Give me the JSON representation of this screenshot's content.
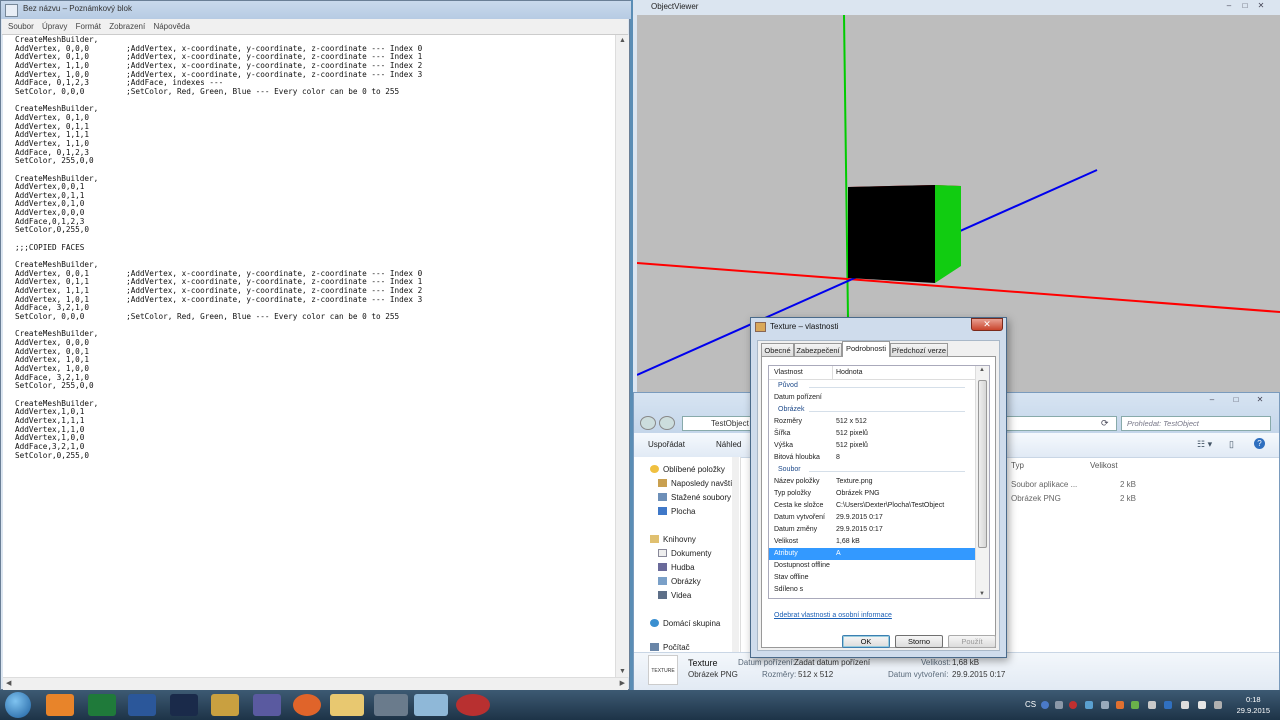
{
  "notepad": {
    "title": "Bez názvu – Poznámkový blok",
    "menu": [
      "Soubor",
      "Úpravy",
      "Formát",
      "Zobrazení",
      "Nápověda"
    ],
    "content": "CreateMeshBuilder,\nAddVertex, 0,0,0        ;AddVertex, x-coordinate, y-coordinate, z-coordinate --- Index 0\nAddVertex, 0,1,0        ;AddVertex, x-coordinate, y-coordinate, z-coordinate --- Index 1\nAddVertex, 1,1,0        ;AddVertex, x-coordinate, y-coordinate, z-coordinate --- Index 2\nAddVertex, 1,0,0        ;AddVertex, x-coordinate, y-coordinate, z-coordinate --- Index 3\nAddFace, 0,1,2,3        ;AddFace, indexes ---\nSetColor, 0,0,0         ;SetColor, Red, Green, Blue --- Every color can be 0 to 255\n\nCreateMeshBuilder,\nAddVertex, 0,1,0\nAddVertex, 0,1,1\nAddVertex, 1,1,1\nAddVertex, 1,1,0\nAddFace, 0,1,2,3\nSetColor, 255,0,0\n\nCreateMeshBuilder,\nAddVertex,0,0,1\nAddVertex,0,1,1\nAddVertex,0,1,0\nAddVertex,0,0,0\nAddFace,0,1,2,3\nSetColor,0,255,0\n\n;;;COPIED FACES\n\nCreateMeshBuilder,\nAddVertex, 0,0,1        ;AddVertex, x-coordinate, y-coordinate, z-coordinate --- Index 0\nAddVertex, 0,1,1        ;AddVertex, x-coordinate, y-coordinate, z-coordinate --- Index 1\nAddVertex, 1,1,1        ;AddVertex, x-coordinate, y-coordinate, z-coordinate --- Index 2\nAddVertex, 1,0,1        ;AddVertex, x-coordinate, y-coordinate, z-coordinate --- Index 3\nAddFace, 3,2,1,0\nSetColor, 0,0,0         ;SetColor, Red, Green, Blue --- Every color can be 0 to 255\n\nCreateMeshBuilder,\nAddVertex, 0,0,0\nAddVertex, 0,0,1\nAddVertex, 1,0,1\nAddVertex, 1,0,0\nAddFace, 3,2,1,0\nSetColor, 255,0,0\n\nCreateMeshBuilder,\nAddVertex,1,0,1\nAddVertex,1,1,1\nAddVertex,1,1,0\nAddVertex,1,0,0\nAddFace,3,2,1,0\nSetColor,0,255,0"
  },
  "viewer": {
    "title": "ObjectViewer",
    "background": "#bdbdbd",
    "axis_colors": {
      "x": "#ff0000",
      "y": "#00cc00",
      "z": "#0000ee"
    }
  },
  "explorer": {
    "address": "TestObject",
    "search_placeholder": "Prohledat: TestObject",
    "toolbar": {
      "organize": "Uspořádat",
      "second": "Náhled"
    },
    "nav": {
      "favorites": "Oblíbené položky",
      "favorites_items": [
        "Naposledy navští",
        "Stažené soubory",
        "Plocha"
      ],
      "libraries": "Knihovny",
      "libraries_items": [
        "Dokumenty",
        "Hudba",
        "Obrázky",
        "Videa"
      ],
      "homegroup": "Domácí skupina",
      "computer": "Počítač"
    },
    "columns": {
      "type": "Typ",
      "size": "Velikost"
    },
    "files": [
      {
        "type": "Soubor aplikace ...",
        "size": "2 kB"
      },
      {
        "type": "Obrázek PNG",
        "size": "2 kB"
      }
    ],
    "details": {
      "thumb_label": "TEXTURE",
      "name": "Texture",
      "type": "Obrázek PNG",
      "date_taken_label": "Datum pořízení:",
      "date_taken_value": "Zadat datum pořízení",
      "size_label": "Velikost:",
      "size_value": "1,68 kB",
      "dimensions_label": "Rozměry:",
      "dimensions_value": "512 x 512",
      "created_label": "Datum vytvoření:",
      "created_value": "29.9.2015 0:17"
    }
  },
  "dialog": {
    "title": "Texture – vlastnosti",
    "tabs": [
      "Obecné",
      "Zabezpečení",
      "Podrobnosti",
      "Předchozí verze"
    ],
    "active_tab": 2,
    "columns": {
      "property": "Vlastnost",
      "value": "Hodnota"
    },
    "rows": [
      {
        "group": "Původ"
      },
      {
        "k": "Datum pořízení",
        "v": ""
      },
      {
        "group": "Obrázek"
      },
      {
        "k": "Rozměry",
        "v": "512 x 512"
      },
      {
        "k": "Šířka",
        "v": "512 pixelů"
      },
      {
        "k": "Výška",
        "v": "512 pixelů"
      },
      {
        "k": "Bitová hloubka",
        "v": "8"
      },
      {
        "group": "Soubor"
      },
      {
        "k": "Název položky",
        "v": "Texture.png"
      },
      {
        "k": "Typ položky",
        "v": "Obrázek PNG"
      },
      {
        "k": "Cesta ke složce",
        "v": "C:\\Users\\Dexter\\Plocha\\TestObject"
      },
      {
        "k": "Datum vytvoření",
        "v": "29.9.2015 0:17"
      },
      {
        "k": "Datum změny",
        "v": "29.9.2015 0:17"
      },
      {
        "k": "Velikost",
        "v": "1,68 kB"
      },
      {
        "k": "Atributy",
        "v": "A",
        "selected": true
      },
      {
        "k": "Dostupnost offline",
        "v": ""
      },
      {
        "k": "Stav offline",
        "v": ""
      },
      {
        "k": "Sdíleno s",
        "v": ""
      }
    ],
    "remove_link": "Odebrat vlastnosti a osobní informace",
    "buttons": {
      "ok": "OK",
      "cancel": "Storno",
      "apply": "Použít"
    }
  },
  "taskbar": {
    "lang": "CS",
    "time": "0:18",
    "date": "29.9.2015"
  }
}
